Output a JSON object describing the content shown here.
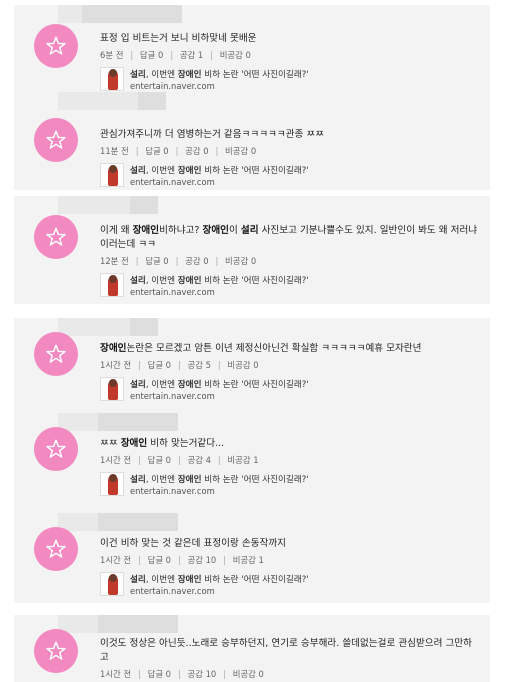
{
  "comments": [
    {
      "text_parts": [
        {
          "t": "표정 입 비트는거 보니 비하맞네 못배운",
          "b": false
        }
      ],
      "time": "6분 전",
      "reply": "답글 0",
      "like": "공감 1",
      "dislike": "비공감 0",
      "show_article": true
    },
    {
      "text_parts": [
        {
          "t": "관심가져주니까 더 염병하는거 같음ㅋㅋㅋㅋㅋ관종 ㅉㅉ",
          "b": false
        }
      ],
      "time": "11분 전",
      "reply": "답글 0",
      "like": "공감 0",
      "dislike": "비공감 0",
      "show_article": true
    },
    {
      "text_parts": [
        {
          "t": "이게 왜 ",
          "b": false
        },
        {
          "t": "장애인",
          "b": true
        },
        {
          "t": "비하냐고? ",
          "b": false
        },
        {
          "t": "장애인",
          "b": true
        },
        {
          "t": "이 ",
          "b": false
        },
        {
          "t": "설리",
          "b": true
        },
        {
          "t": " 사진보고 기분나쁠수도 있지. 일반인이 봐도 왜 저러냐 이러는데 ㅋㅋ",
          "b": false
        }
      ],
      "time": "12분 전",
      "reply": "답글 0",
      "like": "공감 0",
      "dislike": "비공감 0",
      "show_article": true
    },
    {
      "text_parts": [
        {
          "t": "장애인",
          "b": true
        },
        {
          "t": "논란은 모르겠고 암튼 이년 제정신아닌건 확실함 ㅋㅋㅋㅋㅋ예휴 모자란년",
          "b": false
        }
      ],
      "time": "1시간 전",
      "reply": "답글 0",
      "like": "공감 5",
      "dislike": "비공감 0",
      "show_article": true
    },
    {
      "text_parts": [
        {
          "t": "ㅉㅉ ",
          "b": false
        },
        {
          "t": "장애인",
          "b": true
        },
        {
          "t": " 비하 맞는거같다...",
          "b": false
        }
      ],
      "time": "1시간 전",
      "reply": "답글 0",
      "like": "공감 4",
      "dislike": "비공감 1",
      "show_article": true
    },
    {
      "text_parts": [
        {
          "t": "이건 비하 맞는 것 같은데 표정이랑 손동작까지",
          "b": false
        }
      ],
      "time": "1시간 전",
      "reply": "답글 0",
      "like": "공감 10",
      "dislike": "비공감 1",
      "show_article": true
    },
    {
      "text_parts": [
        {
          "t": "이것도 정상은 아닌듯..노래로 승부하던지, 연기로 승부해라. 쓸데없는걸로 관심받으려 그만하고",
          "b": false
        }
      ],
      "time": "1시간 전",
      "reply": "답글 0",
      "like": "공감 10",
      "dislike": "비공감 0",
      "show_article": false
    }
  ],
  "article": {
    "title_parts": [
      {
        "t": "설리",
        "b": true
      },
      {
        "t": ", 이번엔 ",
        "b": false
      },
      {
        "t": "장애인",
        "b": true
      },
      {
        "t": " 비하 논란 '어떤 사진이길래?'",
        "b": false
      }
    ],
    "url": "entertain.naver.com"
  },
  "icons": {
    "avatar": "star-icon",
    "thumbnail": "article-thumbnail-icon"
  },
  "colors": {
    "avatar_bg": "#f289c1",
    "card_bg": "#f3f3f3"
  }
}
